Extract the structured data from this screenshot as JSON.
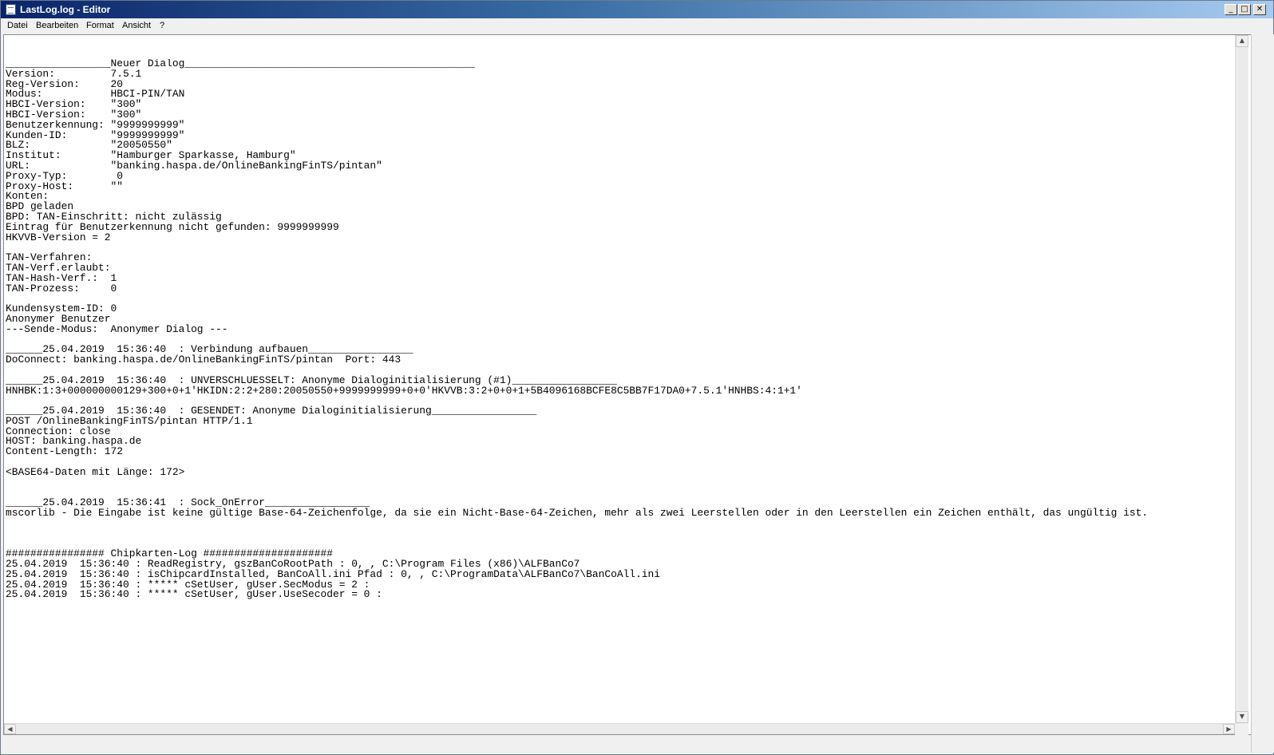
{
  "window": {
    "title": "LastLog.log - Editor",
    "minimize_glyph": "_",
    "maximize_glyph": "□",
    "close_glyph": "✕",
    "app_icon": "notepad-icon"
  },
  "menu": {
    "datei": "Datei",
    "bearbeiten": "Bearbeiten",
    "format": "Format",
    "ansicht": "Ansicht",
    "help": "?"
  },
  "scrollbars": {
    "up_glyph": "▲",
    "down_glyph": "▼",
    "left_glyph": "◀",
    "right_glyph": "▶"
  },
  "document": {
    "lines": [
      "_________________Neuer Dialog_______________________________________________",
      "Version:         7.5.1",
      "Reg-Version:     20",
      "Modus:           HBCI-PIN/TAN",
      "HBCI-Version:    \"300\"",
      "HBCI-Version:    \"300\"",
      "Benutzerkennung: \"9999999999\"",
      "Kunden-ID:       \"9999999999\"",
      "BLZ:             \"20050550\"",
      "Institut:        \"Hamburger Sparkasse, Hamburg\"",
      "URL:             \"banking.haspa.de/OnlineBankingFinTS/pintan\"",
      "Proxy-Typ:        0",
      "Proxy-Host:      \"\"",
      "Konten:",
      "BPD geladen",
      "BPD: TAN-Einschritt: nicht zulässig",
      "Eintrag für Benutzerkennung nicht gefunden: 9999999999",
      "HKVVB-Version = 2",
      "",
      "TAN-Verfahren:",
      "TAN-Verf.erlaubt:",
      "TAN-Hash-Verf.:  1",
      "TAN-Prozess:     0",
      "",
      "Kundensystem-ID: 0",
      "Anonymer Benutzer",
      "---Sende-Modus:  Anonymer Dialog ---",
      "",
      "______25.04.2019  15:36:40  : Verbindung aufbauen_________________",
      "DoConnect: banking.haspa.de/OnlineBankingFinTS/pintan  Port: 443",
      "",
      "______25.04.2019  15:36:40  : UNVERSCHLUESSELT: Anonyme Dialoginitialisierung (#1)_________________",
      "HNHBK:1:3+000000000129+300+0+1'HKIDN:2:2+280:20050550+9999999999+0+0'HKVVB:3:2+0+0+1+5B4096168BCFE8C5BB7F17DA0+7.5.1'HNHBS:4:1+1'",
      "",
      "______25.04.2019  15:36:40  : GESENDET: Anonyme Dialoginitialisierung_________________",
      "POST /OnlineBankingFinTS/pintan HTTP/1.1",
      "Connection: close",
      "HOST: banking.haspa.de",
      "Content-Length: 172",
      "",
      "<BASE64-Daten mit Länge: 172>",
      "",
      "",
      "______25.04.2019  15:36:41  : Sock_OnError_________________",
      "mscorlib - Die Eingabe ist keine gültige Base-64-Zeichenfolge, da sie ein Nicht-Base-64-Zeichen, mehr als zwei Leerstellen oder in den Leerstellen ein Zeichen enthält, das ungültig ist.",
      "",
      "",
      "",
      "################ Chipkarten-Log #####################",
      "25.04.2019  15:36:40 : ReadRegistry, gszBanCoRootPath : 0, , C:\\Program Files (x86)\\ALFBanCo7",
      "25.04.2019  15:36:40 : isChipcardInstalled, BanCoAll.ini Pfad : 0, , C:\\ProgramData\\ALFBanCo7\\BanCoAll.ini",
      "25.04.2019  15:36:40 : ***** cSetUser, gUser.SecModus = 2 :",
      "25.04.2019  15:36:40 : ***** cSetUser, gUser.UseSecoder = 0 :"
    ]
  }
}
